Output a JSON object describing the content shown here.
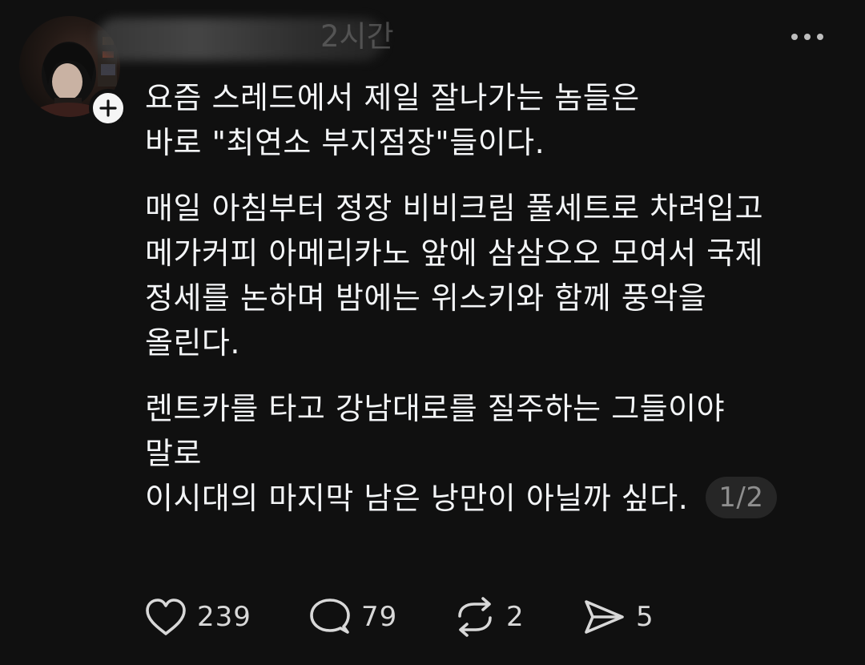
{
  "post": {
    "timestamp": "2시간",
    "body": {
      "para1_line1": "요즘 스레드에서 제일 잘나가는 놈들은",
      "para1_line2": "바로 \"최연소 부지점장\"들이다.",
      "para2_line1": "매일 아침부터 정장 비비크림 풀세트로 차려입고",
      "para2_line2": "메가커피 아메리카노 앞에 삼삼오오 모여서 국제",
      "para2_line3": "정세를 논하며 밤에는 위스키와 함께 풍악을",
      "para2_line4": "올린다.",
      "para3_line1": "렌트카를 타고 강남대로를 질주하는 그들이야",
      "para3_line2": "말로",
      "para3_line3": "이시대의 마지막 남은 낭만이 아닐까 싶다."
    },
    "page_indicator": "1/2"
  },
  "actions": {
    "likes": "239",
    "comments": "79",
    "reposts": "2",
    "shares": "5"
  },
  "icons": {
    "like": "heart-icon",
    "comment": "comment-bubble-icon",
    "repost": "repost-icon",
    "share": "send-icon",
    "more": "more-horizontal-icon",
    "follow": "plus-icon"
  },
  "colors": {
    "background": "#101010",
    "text": "#f3f5f7",
    "muted": "#8e8e8e"
  }
}
